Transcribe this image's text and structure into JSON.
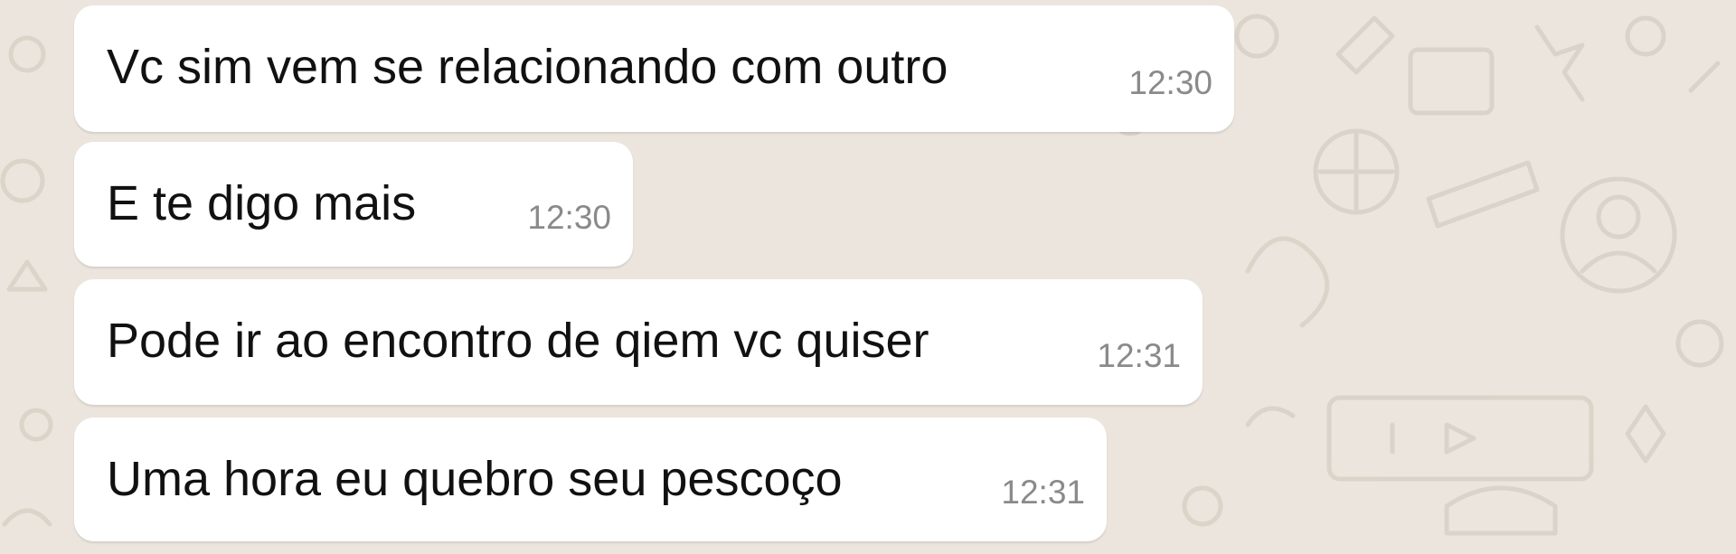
{
  "theme": {
    "wallpaper_color": "#ece5dd",
    "bubble_color": "#ffffff",
    "text_color": "#111111",
    "time_color": "#8a8a8a"
  },
  "messages": [
    {
      "text": "Vc sim vem se relacionando com outro",
      "time": "12:30"
    },
    {
      "text": "E te digo mais",
      "time": "12:30"
    },
    {
      "text": "Pode ir ao encontro de qiem vc quiser",
      "time": "12:31"
    },
    {
      "text": "Uma hora eu quebro seu pescoço",
      "time": "12:31"
    }
  ]
}
